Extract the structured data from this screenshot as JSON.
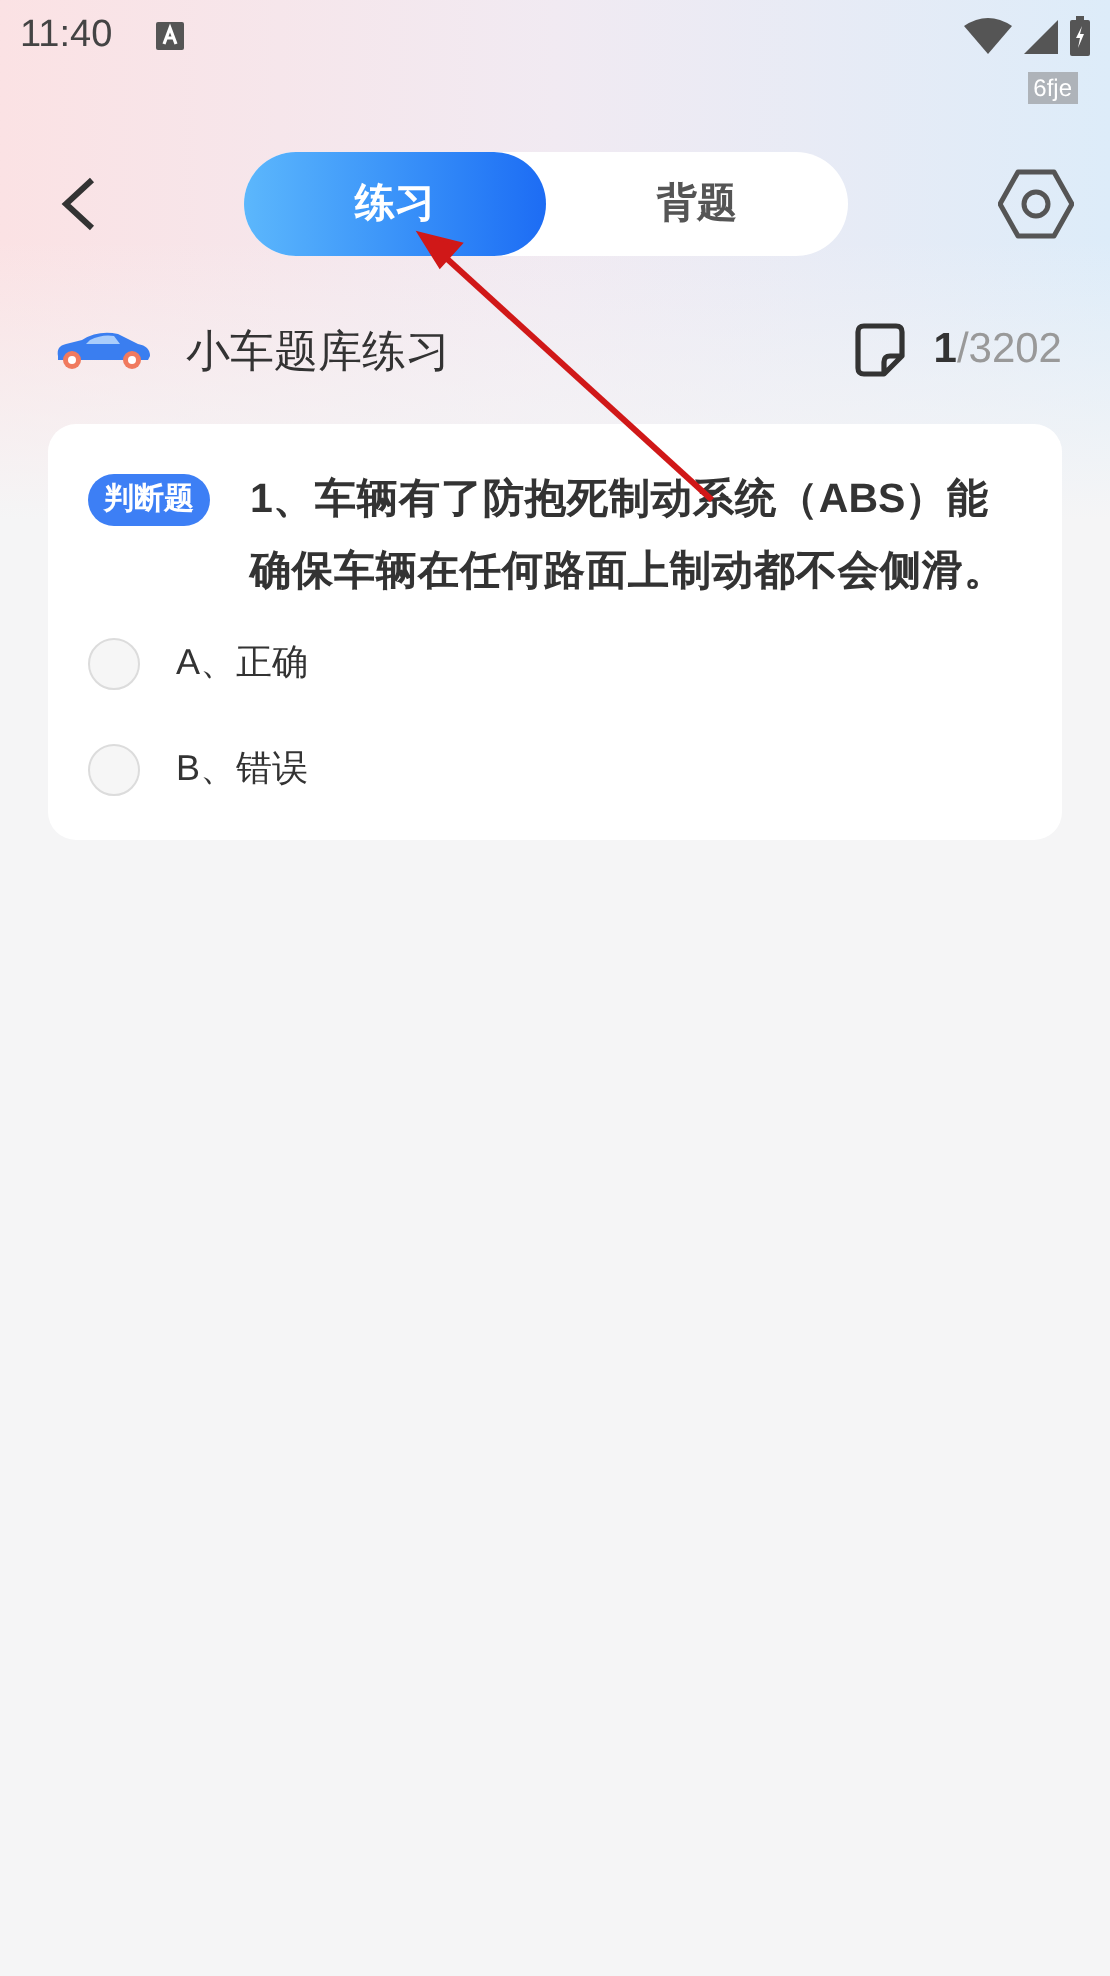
{
  "status_bar": {
    "time": "11:40",
    "tag": "6fje"
  },
  "tabs": [
    {
      "label": "练习",
      "selected": true
    },
    {
      "label": "背题",
      "selected": false
    }
  ],
  "subheader": {
    "title": "小车题库练习",
    "current": "1",
    "total": "/3202"
  },
  "question": {
    "type_badge": "判断题",
    "text": "1、车辆有了防抱死制动系统（ABS）能确保车辆在任何路面上制动都不会侧滑。",
    "options": [
      {
        "label": "A、正确",
        "selected": false
      },
      {
        "label": "B、错误",
        "selected": false
      }
    ]
  }
}
